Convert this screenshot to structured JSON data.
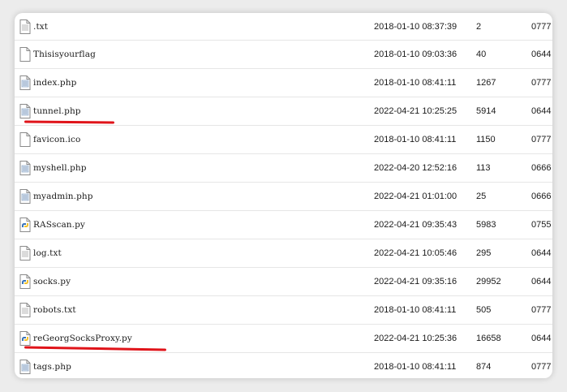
{
  "files": [
    {
      "name": ".txt",
      "icon": "text-file-icon",
      "date": "2018-01-10 08:37:39",
      "size": "2",
      "perm": "0777"
    },
    {
      "name": "Thisisyourflag",
      "icon": "blank-file-icon",
      "date": "2018-01-10 09:03:36",
      "size": "40",
      "perm": "0644"
    },
    {
      "name": "index.php",
      "icon": "php-file-icon",
      "date": "2018-01-10 08:41:11",
      "size": "1267",
      "perm": "0777"
    },
    {
      "name": "tunnel.php",
      "icon": "php-file-icon",
      "date": "2022-04-21 10:25:25",
      "size": "5914",
      "perm": "0644"
    },
    {
      "name": "favicon.ico",
      "icon": "blank-file-icon",
      "date": "2018-01-10 08:41:11",
      "size": "1150",
      "perm": "0777"
    },
    {
      "name": "myshell.php",
      "icon": "php-file-icon",
      "date": "2022-04-20 12:52:16",
      "size": "113",
      "perm": "0666"
    },
    {
      "name": "myadmin.php",
      "icon": "php-file-icon",
      "date": "2022-04-21 01:01:00",
      "size": "25",
      "perm": "0666"
    },
    {
      "name": "RASscan.py",
      "icon": "python-file-icon",
      "date": "2022-04-21 09:35:43",
      "size": "5983",
      "perm": "0755"
    },
    {
      "name": "log.txt",
      "icon": "text-file-icon",
      "date": "2022-04-21 10:05:46",
      "size": "295",
      "perm": "0644"
    },
    {
      "name": "socks.py",
      "icon": "python-file-icon",
      "date": "2022-04-21 09:35:16",
      "size": "29952",
      "perm": "0644"
    },
    {
      "name": "robots.txt",
      "icon": "text-file-icon",
      "date": "2018-01-10 08:41:11",
      "size": "505",
      "perm": "0777"
    },
    {
      "name": "reGeorgSocksProxy.py",
      "icon": "python-file-icon",
      "date": "2022-04-21 10:25:36",
      "size": "16658",
      "perm": "0644"
    },
    {
      "name": "tags.php",
      "icon": "php-file-icon",
      "date": "2018-01-10 08:41:11",
      "size": "874",
      "perm": "0777"
    }
  ],
  "highlight_color": "#e0141a"
}
